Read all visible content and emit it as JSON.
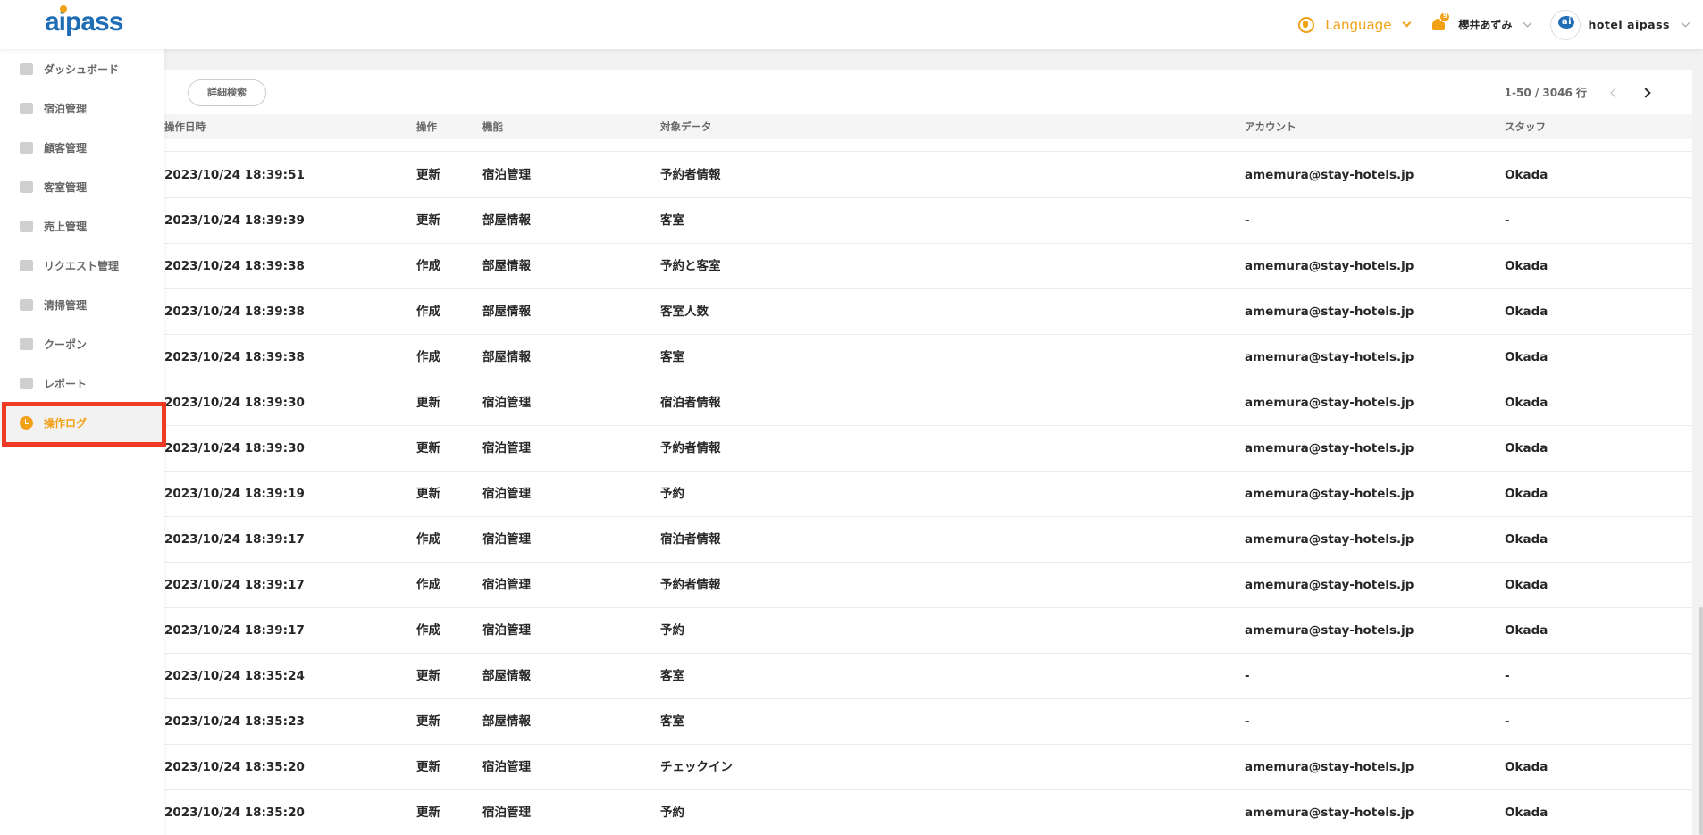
{
  "app": {
    "logo": "aipass"
  },
  "header": {
    "language_label": "Language",
    "notification_count": "9",
    "user_name": "櫻井あずみ",
    "hotel_avatar_text": "ai",
    "hotel_name": "hotel aipass"
  },
  "sidebar": {
    "items": [
      {
        "label": "ダッシュボード",
        "icon": "dashboard-icon"
      },
      {
        "label": "宿泊管理",
        "icon": "bed-icon"
      },
      {
        "label": "顧客管理",
        "icon": "customer-icon"
      },
      {
        "label": "客室管理",
        "icon": "room-icon"
      },
      {
        "label": "売上管理",
        "icon": "calculator-icon"
      },
      {
        "label": "リクエスト管理",
        "icon": "megaphone-icon"
      },
      {
        "label": "清掃管理",
        "icon": "broom-icon"
      },
      {
        "label": "クーポン",
        "icon": "coupon-icon"
      },
      {
        "label": "レポート",
        "icon": "chart-icon"
      },
      {
        "label": "操作ログ",
        "icon": "clock-icon",
        "active": true
      }
    ],
    "highlight_color": "#ef3a25",
    "accent_color": "#f2a116"
  },
  "toolbar": {
    "search_label": "詳細検索",
    "pagination": "1-50 / 3046 行"
  },
  "table": {
    "headers": [
      "操作日時",
      "操作",
      "機能",
      "対象データ",
      "アカウント",
      "スタッフ"
    ],
    "rows": [
      [
        "2023/10/24 18:39:51",
        "更新",
        "宿泊管理",
        "予約者情報",
        "amemura@stay-hotels.jp",
        "Okada"
      ],
      [
        "2023/10/24 18:39:39",
        "更新",
        "部屋情報",
        "客室",
        "-",
        "-"
      ],
      [
        "2023/10/24 18:39:38",
        "作成",
        "部屋情報",
        "予約と客室",
        "amemura@stay-hotels.jp",
        "Okada"
      ],
      [
        "2023/10/24 18:39:38",
        "作成",
        "部屋情報",
        "客室人数",
        "amemura@stay-hotels.jp",
        "Okada"
      ],
      [
        "2023/10/24 18:39:38",
        "作成",
        "部屋情報",
        "客室",
        "amemura@stay-hotels.jp",
        "Okada"
      ],
      [
        "2023/10/24 18:39:30",
        "更新",
        "宿泊管理",
        "宿泊者情報",
        "amemura@stay-hotels.jp",
        "Okada"
      ],
      [
        "2023/10/24 18:39:30",
        "更新",
        "宿泊管理",
        "予約者情報",
        "amemura@stay-hotels.jp",
        "Okada"
      ],
      [
        "2023/10/24 18:39:19",
        "更新",
        "宿泊管理",
        "予約",
        "amemura@stay-hotels.jp",
        "Okada"
      ],
      [
        "2023/10/24 18:39:17",
        "作成",
        "宿泊管理",
        "宿泊者情報",
        "amemura@stay-hotels.jp",
        "Okada"
      ],
      [
        "2023/10/24 18:39:17",
        "作成",
        "宿泊管理",
        "予約者情報",
        "amemura@stay-hotels.jp",
        "Okada"
      ],
      [
        "2023/10/24 18:39:17",
        "作成",
        "宿泊管理",
        "予約",
        "amemura@stay-hotels.jp",
        "Okada"
      ],
      [
        "2023/10/24 18:35:24",
        "更新",
        "部屋情報",
        "客室",
        "-",
        "-"
      ],
      [
        "2023/10/24 18:35:23",
        "更新",
        "部屋情報",
        "客室",
        "-",
        "-"
      ],
      [
        "2023/10/24 18:35:20",
        "更新",
        "宿泊管理",
        "チェックイン",
        "amemura@stay-hotels.jp",
        "Okada"
      ],
      [
        "2023/10/24 18:35:20",
        "更新",
        "宿泊管理",
        "予約",
        "amemura@stay-hotels.jp",
        "Okada"
      ]
    ]
  }
}
